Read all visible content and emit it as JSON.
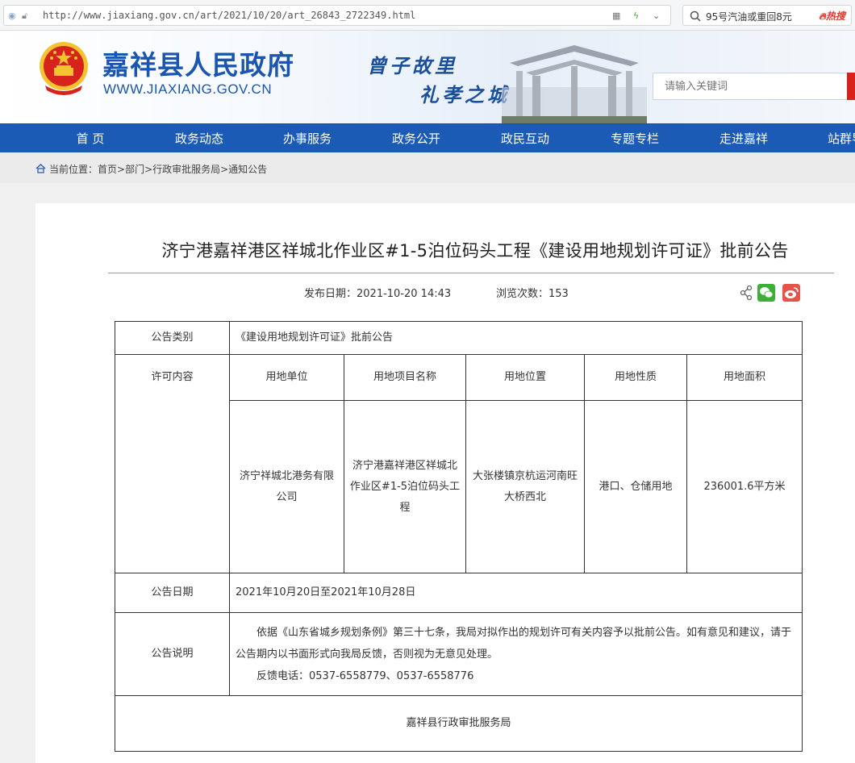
{
  "browser": {
    "url": "http://www.jiaxiang.gov.cn/art/2021/10/20/art_26843_2722349.html",
    "search_text": "95号汽油或重回8元",
    "hot_label": "热搜"
  },
  "header": {
    "site_name": "嘉祥县人民政府",
    "site_domain": "WWW.JIAXIANG.GOV.CN",
    "slogan_line1": "曾子故里",
    "slogan_line2": "礼孝之城",
    "search_placeholder": "请输入关键词"
  },
  "nav": {
    "items": [
      "首 页",
      "政务动态",
      "办事服务",
      "政务公开",
      "政民互动",
      "专题专栏",
      "走进嘉祥",
      "站群导航"
    ]
  },
  "breadcrumb": {
    "label": "当前位置：",
    "path": "首页>部门>行政审批服务局>通知公告"
  },
  "article": {
    "title": "济宁港嘉祥港区祥城北作业区#1-5泊位码头工程《建设用地规划许可证》批前公告",
    "publish_label": "发布日期：2021-10-20 14:43",
    "views_label": "浏览次数：153"
  },
  "table": {
    "category_label": "公告类别",
    "category_value": "《建设用地规划许可证》批前公告",
    "permit_label": "许可内容",
    "headers": [
      "用地单位",
      "用地项目名称",
      "用地位置",
      "用地性质",
      "用地面积"
    ],
    "row": [
      "济宁祥城北港务有限公司",
      "济宁港嘉祥港区祥城北作业区#1-5泊位码头工程",
      "大张楼镇京杭运河南旺大桥西北",
      "港口、仓储用地",
      "236001.6平方米"
    ],
    "date_label": "公告日期",
    "date_value": "2021年10月20日至2021年10月28日",
    "desc_label": "公告说明",
    "desc_text": "依据《山东省城乡规划条例》第三十七条，我局对拟作出的规划许可有关内容予以批前公告。如有意见和建议，请于公告期内以书面形式向我局反馈，否则视为无意见处理。",
    "desc_phone": "反馈电话：0537-6558779、0537-6558776",
    "footer": "嘉祥县行政审批服务局"
  },
  "colors": {
    "brand_blue": "#1b5bb5",
    "search_red": "#d8231d",
    "wechat_green": "#3cb034",
    "weibo_red": "#e6534b"
  }
}
